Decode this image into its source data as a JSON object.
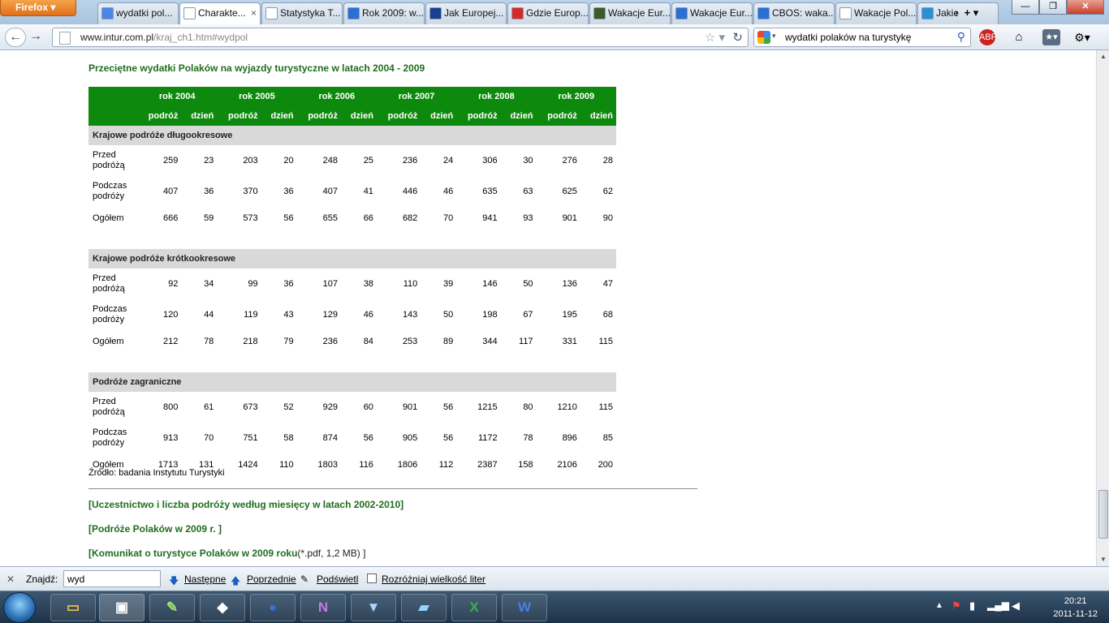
{
  "browser": {
    "app_button": "Firefox",
    "tabs": [
      {
        "label": "wydatki pol...",
        "color": "#4a86e8",
        "active": false
      },
      {
        "label": "Charakte...",
        "color": "#ffffff",
        "active": true
      },
      {
        "label": "Statystyka T...",
        "color": "#ffffff",
        "active": false
      },
      {
        "label": "Rok 2009: w...",
        "color": "#2a6fd6",
        "active": false
      },
      {
        "label": "Jak Europej...",
        "color": "#1a3f8f",
        "active": false
      },
      {
        "label": "Gdzie Europ...",
        "color": "#d62a2a",
        "active": false
      },
      {
        "label": "Wakacje Eur...",
        "color": "#3a5a2a",
        "active": false
      },
      {
        "label": "Wakacje Eur...",
        "color": "#2a6fd6",
        "active": false
      },
      {
        "label": "CBOS: waka...",
        "color": "#2a6fd6",
        "active": false
      },
      {
        "label": "Wakacje Pol...",
        "color": "#ffffff",
        "active": false
      },
      {
        "label": "Jakie",
        "color": "#2a8fd6",
        "active": false
      }
    ],
    "url_host": "www.intur.com.pl",
    "url_path": "/kraj_ch1.htm#wydpol",
    "search_query": "wydatki polaków na turystykę"
  },
  "page": {
    "title": "Przeciętne wydatki Polaków na wyjazdy turystyczne w latach 2004 - 2009",
    "years": [
      "rok 2004",
      "rok 2005",
      "rok 2006",
      "rok 2007",
      "rok 2008",
      "rok 2009"
    ],
    "sub_headers": [
      "podróż",
      "dzień"
    ],
    "sections": [
      {
        "name": "Krajowe podróże długookresowe",
        "rows": [
          {
            "label": "Przed podróżą",
            "values": [
              "259",
              "23",
              "203",
              "20",
              "248",
              "25",
              "236",
              "24",
              "306",
              "30",
              "276",
              "28"
            ]
          },
          {
            "label": "Podczas podróży",
            "values": [
              "407",
              "36",
              "370",
              "36",
              "407",
              "41",
              "446",
              "46",
              "635",
              "63",
              "625",
              "62"
            ]
          },
          {
            "label": "Ogółem",
            "values": [
              "666",
              "59",
              "573",
              "56",
              "655",
              "66",
              "682",
              "70",
              "941",
              "93",
              "901",
              "90"
            ]
          }
        ]
      },
      {
        "name": "Krajowe podróże krótkookresowe",
        "rows": [
          {
            "label": "Przed podróżą",
            "values": [
              "92",
              "34",
              "99",
              "36",
              "107",
              "38",
              "110",
              "39",
              "146",
              "50",
              "136",
              "47"
            ]
          },
          {
            "label": "Podczas podróży",
            "values": [
              "120",
              "44",
              "119",
              "43",
              "129",
              "46",
              "143",
              "50",
              "198",
              "67",
              "195",
              "68"
            ]
          },
          {
            "label": "Ogółem",
            "values": [
              "212",
              "78",
              "218",
              "79",
              "236",
              "84",
              "253",
              "89",
              "344",
              "117",
              "331",
              "115"
            ]
          }
        ]
      },
      {
        "name": "Podróże zagraniczne",
        "rows": [
          {
            "label": "Przed podróżą",
            "values": [
              "800",
              "61",
              "673",
              "52",
              "929",
              "60",
              "901",
              "56",
              "1215",
              "80",
              "1210",
              "115"
            ]
          },
          {
            "label": "Podczas podróży",
            "values": [
              "913",
              "70",
              "751",
              "58",
              "874",
              "56",
              "905",
              "56",
              "1172",
              "78",
              "896",
              "85"
            ]
          },
          {
            "label": "Ogółem",
            "values": [
              "1713",
              "131",
              "1424",
              "110",
              "1803",
              "116",
              "1806",
              "112",
              "2387",
              "158",
              "2106",
              "200"
            ]
          }
        ]
      }
    ],
    "source": "Źródło: badania Instytutu Turystyki",
    "links": [
      {
        "text": "[Uczestnictwo i liczba podróży według miesięcy w latach 2002-2010]",
        "extra": ""
      },
      {
        "text": "[Podróże Polaków w 2009 r. ]",
        "extra": ""
      },
      {
        "text": "[Komunikat o turystyce Polaków w 2009 roku",
        "extra": "(*.pdf, 1,2 MB) ]"
      }
    ]
  },
  "findbar": {
    "label": "Znajdź:",
    "value": "wyd",
    "next": "Następne",
    "prev": "Poprzednie",
    "highlight": "Podświetl",
    "match_case": "Rozróżniaj wielkość liter"
  },
  "taskbar": {
    "time": "20:21",
    "date": "2011-11-12"
  }
}
